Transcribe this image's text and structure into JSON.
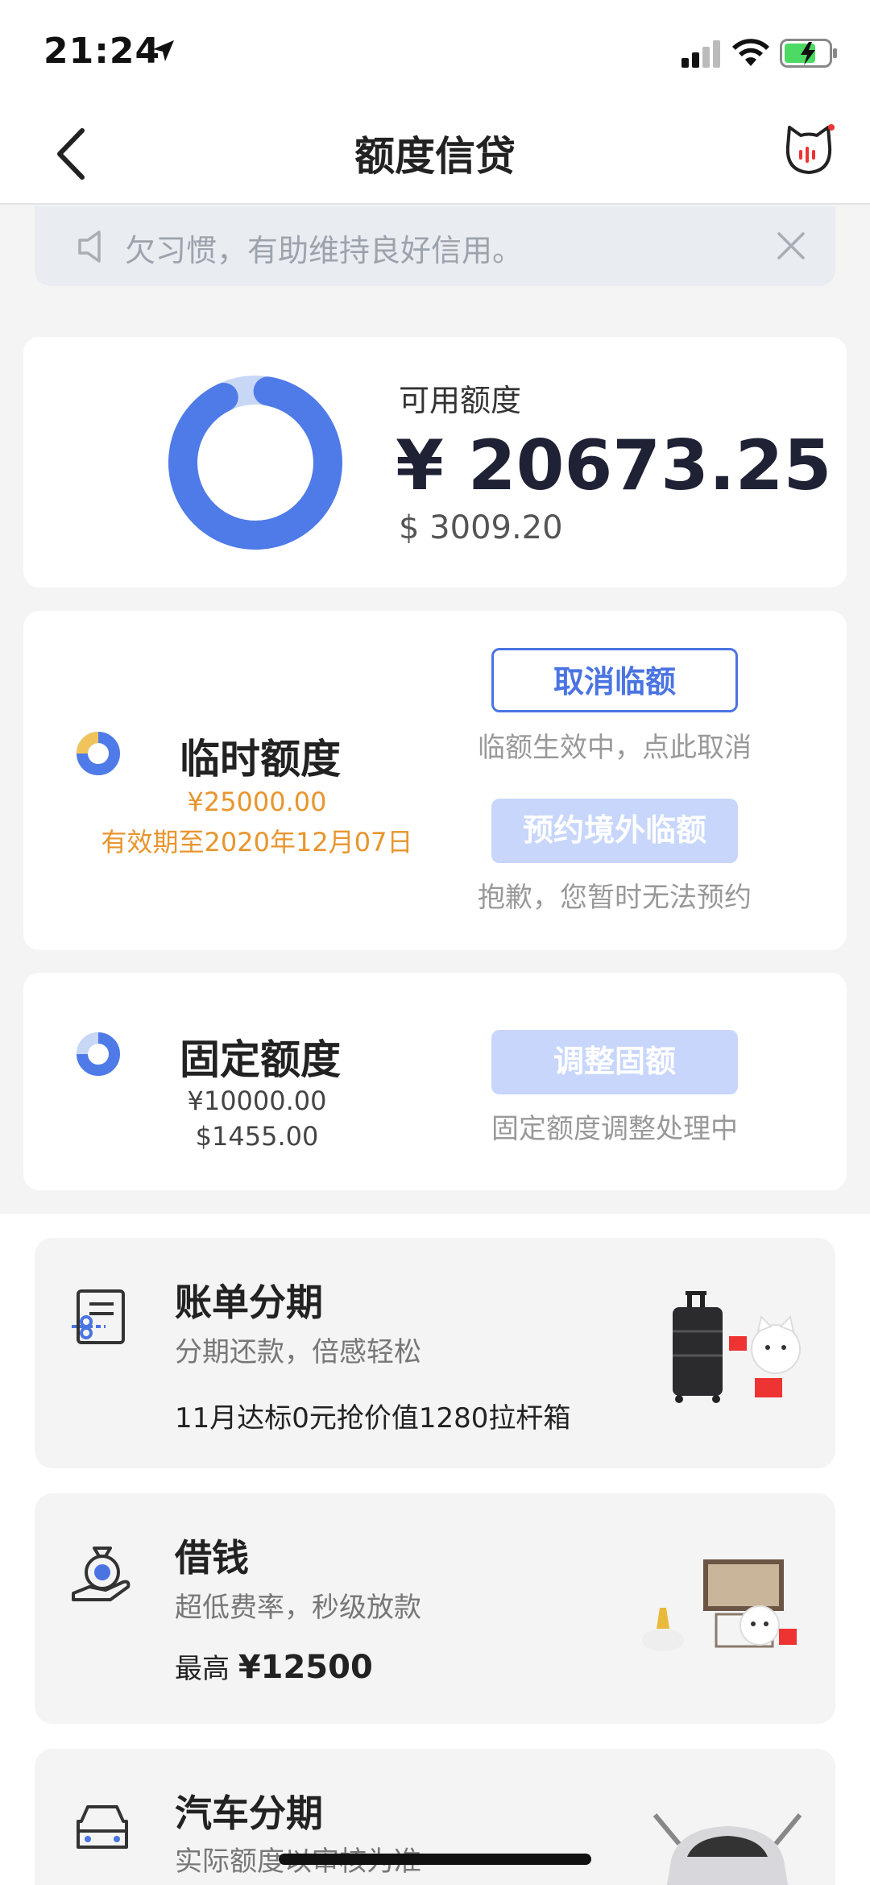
{
  "status_bar": {
    "time": "21:24"
  },
  "nav": {
    "title": "额度信贷"
  },
  "notice": {
    "text": "欠习惯，有助维持良好信用。"
  },
  "available": {
    "label": "可用额度",
    "cny": "¥ 20673.25",
    "usd": "$ 3009.20",
    "ring_used_fraction": 0.9,
    "ring_color": "#4f7be8",
    "ring_track_color": "#c9d7f7"
  },
  "temp_quota": {
    "title": "临时额度",
    "amount": "¥25000.00",
    "validity": "有效期至2020年12月07日",
    "cancel_button": "取消临额",
    "cancel_note": "临额生效中，点此取消",
    "overseas_button": "预约境外临额",
    "overseas_note": "抱歉，您暂时无法预约"
  },
  "fixed_quota": {
    "title": "固定额度",
    "cny": "¥10000.00",
    "usd": "$1455.00",
    "adjust_button": "调整固额",
    "adjust_note": "固定额度调整处理中"
  },
  "promos": [
    {
      "title": "账单分期",
      "subtitle": "分期还款，倍感轻松",
      "extra": "11月达标0元抢价值1280拉杆箱",
      "icon": "bill-installment-icon"
    },
    {
      "title": "借钱",
      "subtitle": "超低费率，秒级放款",
      "extra_prefix": "最高",
      "extra_amount": "¥12500",
      "icon": "money-bag-icon"
    },
    {
      "title": "汽车分期",
      "subtitle": "实际额度以审核为准",
      "icon": "car-icon"
    }
  ],
  "colors": {
    "accent": "#4a74e2",
    "orange": "#e8952e",
    "disabled": "#c7d6fa"
  }
}
